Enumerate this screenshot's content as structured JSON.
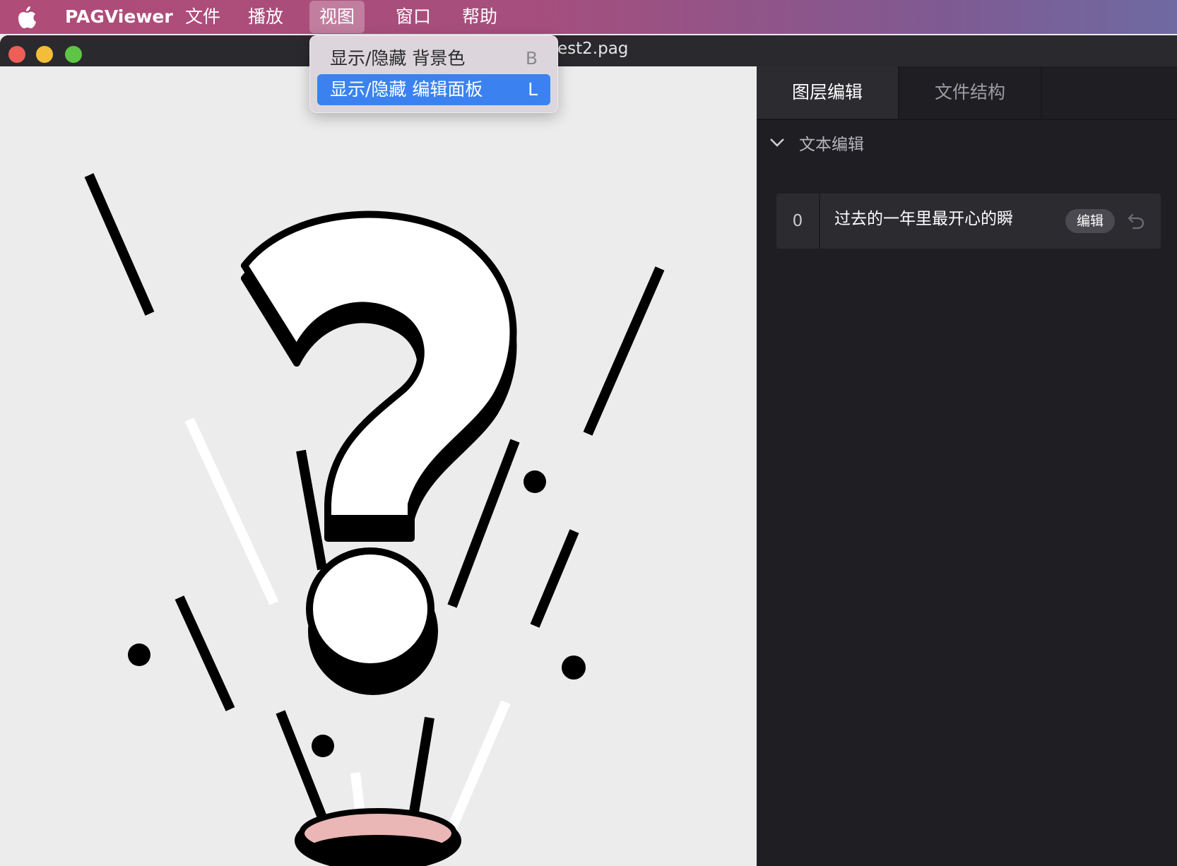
{
  "menubar": {
    "app_name": "PAGViewer",
    "items": [
      "文件",
      "播放",
      "视图",
      "窗口",
      "帮助"
    ],
    "active_item": "视图"
  },
  "window": {
    "title": "test2.pag"
  },
  "dropdown": {
    "items": [
      {
        "label": "显示/隐藏 背景色",
        "shortcut": "B"
      },
      {
        "label": "显示/隐藏 编辑面板",
        "shortcut": "L"
      }
    ]
  },
  "panel": {
    "tabs": [
      "图层编辑",
      "文件结构"
    ],
    "active_tab": "图层编辑",
    "section_title": "文本编辑",
    "text_layers": [
      {
        "index": "0",
        "text": "过去的一年里最开心的瞬",
        "edit_label": "编辑"
      }
    ]
  },
  "colors": {
    "accent": "#3b82f0",
    "canvas_bg": "#ececec",
    "panel_bg": "#1f1f23"
  },
  "icons": [
    "apple-icon",
    "chevron-down-icon",
    "undo-icon"
  ]
}
